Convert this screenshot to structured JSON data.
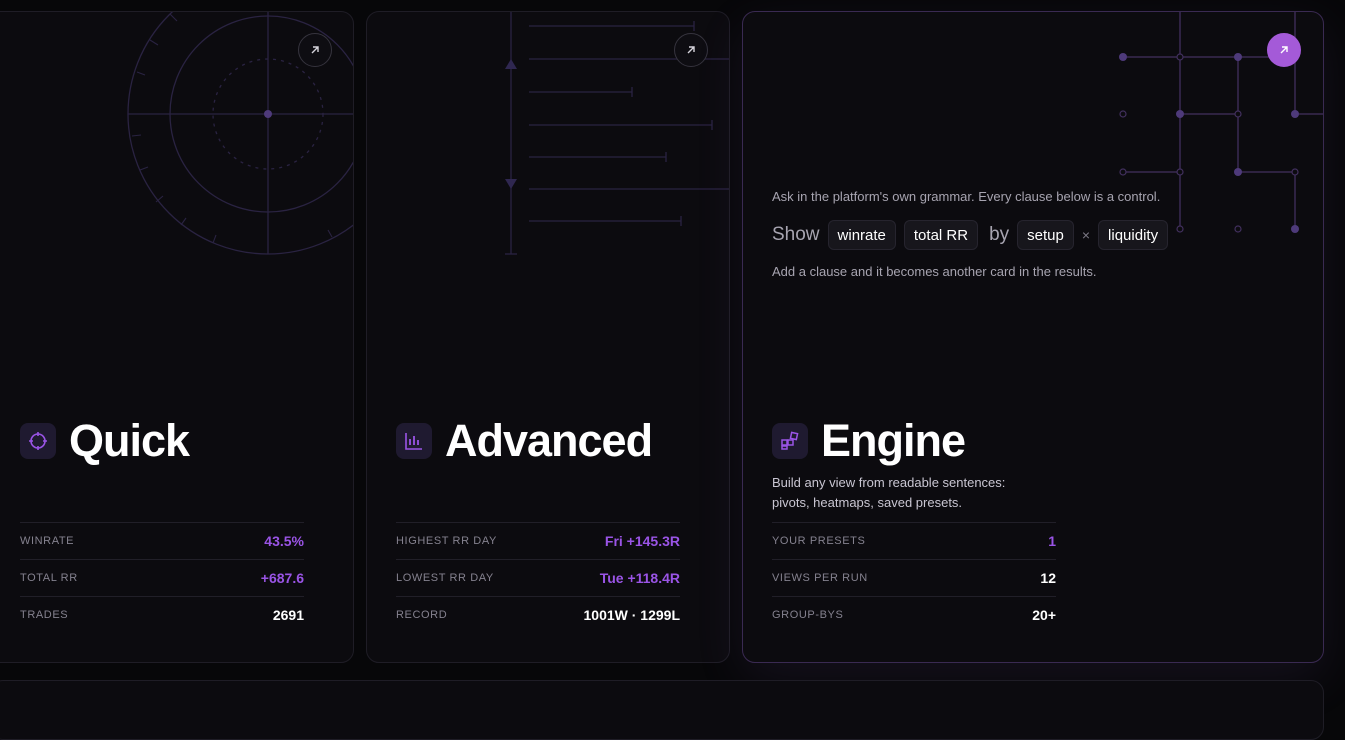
{
  "cards": {
    "quick": {
      "title": "Quick",
      "stats": [
        {
          "label": "WINRATE",
          "value": "43.5%"
        },
        {
          "label": "TOTAL RR",
          "value": "+687.6"
        },
        {
          "label": "TRADES",
          "value": "2691"
        }
      ]
    },
    "advanced": {
      "title": "Advanced",
      "stats": [
        {
          "label": "HIGHEST RR DAY",
          "value": "Fri +145.3R"
        },
        {
          "label": "LOWEST RR DAY",
          "value": "Tue +118.4R"
        },
        {
          "label": "RECORD",
          "value": "1001W · 1299L"
        }
      ]
    },
    "engine": {
      "title": "Engine",
      "intro": "Ask in the platform's own grammar. Every clause below is a control.",
      "grammar": {
        "show": "Show",
        "chip_a": "winrate",
        "chip_b": "total RR",
        "by": "by",
        "chip_c": "setup",
        "times": "×",
        "chip_d": "liquidity"
      },
      "after": "Add a clause and it becomes another card in the results.",
      "description": "Build any view from readable sentences: pivots, heatmaps, saved presets.",
      "stats": [
        {
          "label": "YOUR PRESETS",
          "value": "1"
        },
        {
          "label": "VIEWS PER RUN",
          "value": "12"
        },
        {
          "label": "GROUP-BYS",
          "value": "20+"
        }
      ]
    }
  },
  "icons": {
    "quick": "crosshair-icon",
    "advanced": "chart-bars-icon",
    "engine": "blocks-icon",
    "open": "arrow-up-right-icon"
  },
  "colors": {
    "accent": "#9a54e6",
    "accent_button": "#a45ad8",
    "card_bg": "#0c0b0f",
    "page_bg": "#070709"
  }
}
